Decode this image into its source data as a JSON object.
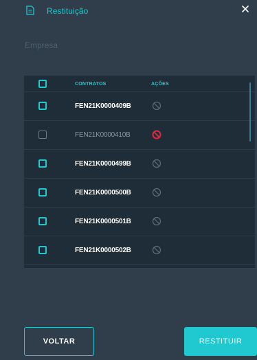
{
  "header": {
    "title": "Restituição",
    "doc_icon": "document-icon",
    "close_icon": "close-icon"
  },
  "form": {
    "company_label": "Empresa"
  },
  "table": {
    "headers": {
      "contracts": "CONTRATOS",
      "actions": "AÇÕES"
    },
    "rows": [
      {
        "code": "FEN21K0000409B",
        "disabled": false,
        "action_icon": "disabled-circle-icon"
      },
      {
        "code": "FEN21K0000410B",
        "disabled": true,
        "action_icon": "blocked-red-icon"
      },
      {
        "code": "FEN21K0000499B",
        "disabled": false,
        "action_icon": "disabled-circle-icon"
      },
      {
        "code": "FEN21K0000500B",
        "disabled": false,
        "action_icon": "disabled-circle-icon"
      },
      {
        "code": "FEN21K0000501B",
        "disabled": false,
        "action_icon": "disabled-circle-icon"
      },
      {
        "code": "FEN21K0000502B",
        "disabled": false,
        "action_icon": "disabled-circle-icon"
      }
    ]
  },
  "buttons": {
    "back": "VOLTAR",
    "restore": "RESTITUIR"
  },
  "colors": {
    "accent": "#20c8cf",
    "background": "#2f3e4a",
    "panel": "#1e2d38",
    "blocked": "#e0283c"
  }
}
